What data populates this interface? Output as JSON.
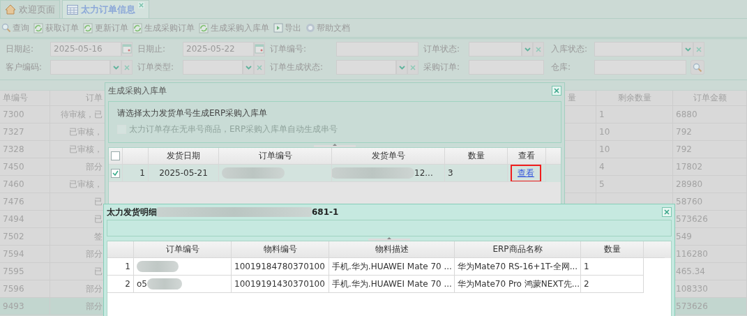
{
  "tabs": [
    {
      "label": "欢迎页面",
      "selected": false,
      "closable": false
    },
    {
      "label": "太力订单信息",
      "selected": true,
      "closable": true
    }
  ],
  "toolbar": [
    {
      "label": "查询"
    },
    {
      "label": "获取订单"
    },
    {
      "label": "更新订单"
    },
    {
      "label": "生成采购订单"
    },
    {
      "label": "生成采购入库单"
    },
    {
      "label": "导出"
    },
    {
      "label": "帮助文档"
    }
  ],
  "filters": [
    {
      "label": "日期起:",
      "kind": "date",
      "value": "2025-05-16"
    },
    {
      "label": "日期止:",
      "kind": "date",
      "value": "2025-05-22"
    },
    {
      "label": "订单编号:",
      "kind": "text"
    },
    {
      "label": "订单状态:",
      "kind": "combo"
    },
    {
      "label": "入库状态:",
      "kind": "combo"
    },
    {
      "label": "客户编码:",
      "kind": "combo"
    },
    {
      "label": "订单类型:",
      "kind": "combo"
    },
    {
      "label": "订单生成状态:",
      "kind": "combo"
    },
    {
      "label": "采购订单:",
      "kind": "text"
    },
    {
      "label": "仓库:",
      "kind": "lookup"
    }
  ],
  "table": {
    "columns": [
      "单编号",
      "订单",
      "量",
      "剩余数量",
      "订单金额"
    ],
    "rows": [
      {
        "selected": false,
        "cells": [
          "7300",
          "待审核，已",
          "",
          "1",
          "6880"
        ]
      },
      {
        "selected": false,
        "cells": [
          "7327",
          "已审核，",
          "",
          "10",
          "792"
        ]
      },
      {
        "selected": false,
        "cells": [
          "7328",
          "已审核，",
          "",
          "10",
          "792"
        ]
      },
      {
        "selected": false,
        "cells": [
          "7450",
          "部分",
          "",
          "4",
          "17802"
        ]
      },
      {
        "selected": false,
        "cells": [
          "7460",
          "已审核，",
          "",
          "5",
          "28980"
        ]
      },
      {
        "selected": false,
        "cells": [
          "7476",
          "已",
          "",
          "",
          "58760"
        ]
      },
      {
        "selected": false,
        "cells": [
          "7494",
          "已",
          "",
          "",
          "573626"
        ]
      },
      {
        "selected": false,
        "cells": [
          "7502",
          "签",
          "",
          "",
          "549"
        ]
      },
      {
        "selected": false,
        "cells": [
          "7594",
          "部分",
          "",
          "",
          "116280"
        ]
      },
      {
        "selected": false,
        "cells": [
          "7595",
          "已",
          "",
          "",
          "465.34"
        ]
      },
      {
        "selected": false,
        "cells": [
          "7596",
          "部分",
          "",
          "",
          "108330"
        ]
      },
      {
        "selected": true,
        "cells": [
          "9493",
          "部分",
          "",
          "",
          "573626"
        ]
      }
    ]
  },
  "dialogs": [
    {
      "title": "生成采购入库单",
      "message": "请选择太力发货单号生成ERP采购入库单",
      "option": {
        "label": "太力订单存在无串号商品，ERP采购入库单自动生成串号",
        "disabled": true
      },
      "grid": {
        "header_checked": false,
        "columns": [
          "发货日期",
          "订单编号",
          "发货单号",
          "数量",
          "查看"
        ],
        "rows": [
          {
            "checked": true,
            "number": "1",
            "cells": [
              {
                "text": "2025-05-21"
              },
              {
                "redacted": true
              },
              {
                "text": "12...",
                "redacted": true
              },
              {
                "text": "3"
              },
              {
                "link": "查看",
                "highlighted": true
              }
            ]
          }
        ]
      }
    },
    {
      "title": "太力发货明细",
      "title_end": "681-1",
      "grid": {
        "columns": [
          "订单编号",
          "物料编号",
          "物料描述",
          "ERP商品名称",
          "数量"
        ],
        "rows": [
          {
            "number": "1",
            "cells": [
              {
                "redacted": true
              },
              {
                "text": "10019184780370100"
              },
              {
                "text": "手机.华为.HUAWEI Mate 70 ..."
              },
              {
                "text": "华为Mate70 RS-16+1T-全网..."
              },
              {
                "text": "1"
              }
            ]
          },
          {
            "number": "2",
            "cells": [
              {
                "text": "o5",
                "redacted": true
              },
              {
                "text": "10019191430370100"
              },
              {
                "text": "手机.华为.HUAWEI Mate 70 ..."
              },
              {
                "text": "华为Mate70 Pro 鸿蒙NEXT先..."
              },
              {
                "text": "2"
              }
            ]
          }
        ]
      }
    }
  ]
}
